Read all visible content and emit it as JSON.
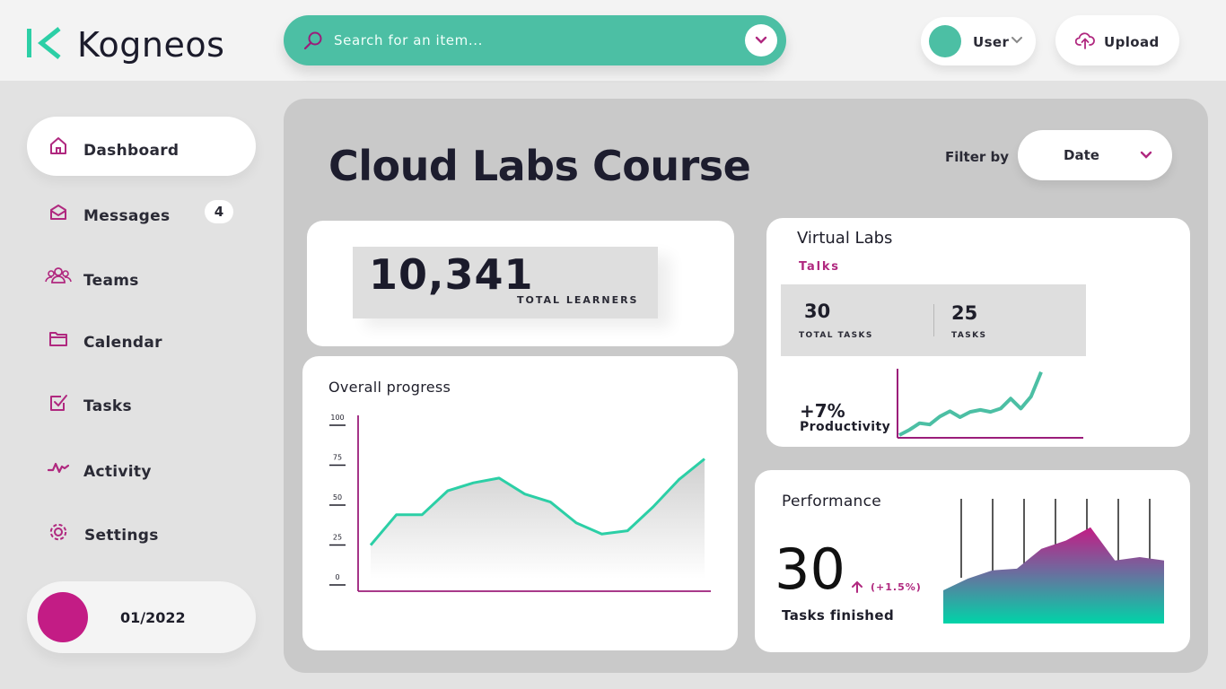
{
  "brand": {
    "name": "Kogneos",
    "accent": "#4cbfa4",
    "magenta": "#b0287f"
  },
  "search": {
    "placeholder": "Search for an item...",
    "icon": "search-icon"
  },
  "header": {
    "user_label": "User",
    "upload_label": "Upload"
  },
  "sidebar": {
    "items": [
      {
        "label": "Dashboard",
        "icon": "home-icon",
        "active": true
      },
      {
        "label": "Messages",
        "icon": "envelope-icon",
        "badge": "4"
      },
      {
        "label": "Teams",
        "icon": "team-icon"
      },
      {
        "label": "Calendar",
        "icon": "folder-icon"
      },
      {
        "label": "Tasks",
        "icon": "checkbox-icon"
      },
      {
        "label": "Activity",
        "icon": "activity-icon"
      },
      {
        "label": "Settings",
        "icon": "gear-icon"
      }
    ],
    "date": "01/2022"
  },
  "main": {
    "title": "Cloud Labs Course",
    "filter_label": "Filter by",
    "filter_value": "Date"
  },
  "learners": {
    "value": "10,341",
    "label": "TOTAL LEARNERS"
  },
  "virtual_labs": {
    "title": "Virtual Labs",
    "subtitle": "Talks",
    "total_tasks": "30",
    "total_tasks_label": "TOTAL TASKS",
    "tasks": "25",
    "tasks_label": "TASKS",
    "productivity_value": "+7%",
    "productivity_label": "Productivity"
  },
  "performance": {
    "title": "Performance",
    "value": "30",
    "change": "(+1.5%)",
    "label": "Tasks finished"
  },
  "chart_data": [
    {
      "type": "area",
      "title": "Overall progress",
      "y_ticks": [
        "0",
        "25",
        "50",
        "75",
        "100"
      ],
      "ylim": [
        0,
        100
      ],
      "values": [
        21,
        40,
        40,
        55,
        60,
        63,
        53,
        48,
        35,
        28,
        30,
        45,
        62,
        75
      ],
      "grid": false,
      "line_color": "#2ccfa6"
    },
    {
      "type": "line",
      "title": "",
      "values": [
        0,
        8,
        18,
        16,
        28,
        36,
        27,
        35,
        38,
        35,
        40,
        55,
        40,
        58,
        95
      ],
      "line_color": "#4cbfa4"
    },
    {
      "type": "area",
      "title": "",
      "values": [
        20,
        27,
        32,
        33,
        45,
        50,
        58,
        38,
        40,
        38
      ],
      "bar_lines": 7,
      "gradient": [
        "#00d4a8",
        "#c31c85"
      ]
    }
  ]
}
